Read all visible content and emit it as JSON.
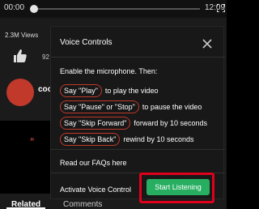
{
  "player": {
    "time_start": "00:00",
    "time_end": "12:09"
  },
  "page": {
    "views": "2.3M Views",
    "likes": "92",
    "channel_name": "coo",
    "preview_logo": "ᴴ",
    "tabs": [
      {
        "label": "Related"
      },
      {
        "label": "Comments"
      }
    ]
  },
  "modal": {
    "title": "Voice Controls",
    "intro": "Enable the microphone. Then:",
    "commands": [
      {
        "phrase": "Say \"Play\"",
        "desc": "to play the video"
      },
      {
        "phrase": "Say \"Pause\" or \"Stop\"",
        "desc": "to pause the video"
      },
      {
        "phrase": "Say \"Skip Forward\"",
        "desc": "forward by 10 seconds"
      },
      {
        "phrase": "Say \"Skip Back\"",
        "desc": "rewind by 10 seconds"
      }
    ],
    "faq_link": "Read our FAQs here",
    "activate_label": "Activate Voice Control",
    "start_button": "Start Listening"
  },
  "colors": {
    "accent_green": "#27ae60",
    "pill_border": "#c0392b",
    "highlight_red": "#e0001b"
  }
}
